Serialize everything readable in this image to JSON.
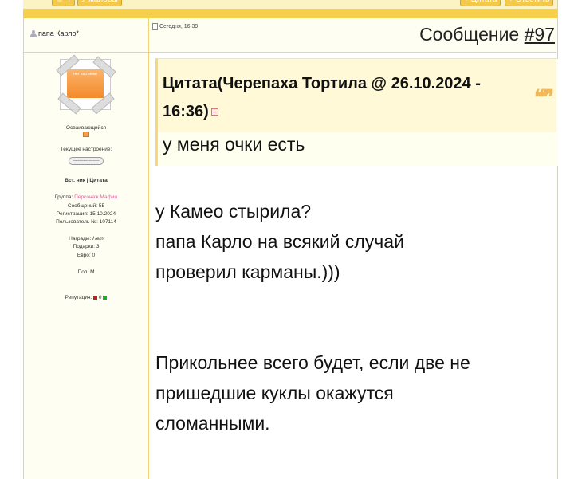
{
  "topbar": {
    "buttons": [
      "☺",
      "/",
      "У жалобы"
    ],
    "right_buttons": [
      "+ Цитата",
      "+ Ответить"
    ]
  },
  "post": {
    "author": "папа Карло*",
    "date": "Сегодня, 16:39",
    "message_label": "Сообщение",
    "message_number": "#97"
  },
  "sidebar": {
    "avatar_text": "нет картинки",
    "rank": "Осваивающийся",
    "mood_label": "Текущее настроение:",
    "mood_value": "--------------------",
    "nick_links": "Вст. ник | Цитата",
    "group_label": "Группа:",
    "group_value": "Персонаж Мафии",
    "messages": "Сообщений: 55",
    "registration": "Регистрация: 15.10.2024",
    "user_no": "Пользователь №: 107114",
    "awards_label": "Награды:",
    "awards_value": "Нет",
    "gifts_label": "Подарки:",
    "gifts_value": "3",
    "euro": "Евро: 0",
    "gender": "Пол: М",
    "rep_label": "Репутация:",
    "rep_value": "0"
  },
  "quote": {
    "title": "Цитата(Черепаха Тортила @ 26.10.2024 - 16:36)",
    "text": "у меня очки есть"
  },
  "body": {
    "lines1": [
      "у Камео стырила?",
      "папа Карло на всякий случай",
      "проверил карманы.)))"
    ],
    "lines2": [
      "Прикольнее всего будет, если две не",
      "пришедшие куклы окажутся",
      "сломанными."
    ]
  },
  "colors": {
    "accent": "#f6d04d",
    "panel": "#fffef2",
    "border": "#efd27a",
    "group": "#e060a0"
  }
}
